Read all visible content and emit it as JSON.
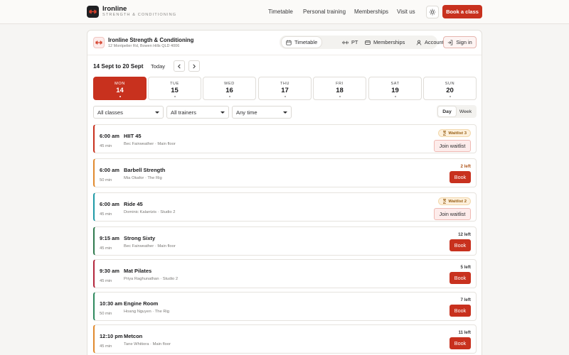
{
  "app": {
    "name": "Ironline",
    "tagline": "STRENGTH & CONDITIONING"
  },
  "nav": {
    "links": [
      "Timetable",
      "Personal training",
      "Memberships",
      "Visit us"
    ],
    "cta": "Book a class",
    "theme_icon": "sun-icon"
  },
  "gym": {
    "name": "Ironline Strength & Conditioning",
    "address": "12 Montpelier Rd, Bowen Hills QLD 4006"
  },
  "tabs": [
    {
      "label": "Timetable",
      "icon": "calendar-icon",
      "active": true
    },
    {
      "label": "PT",
      "icon": "dumbbell-icon",
      "active": false
    },
    {
      "label": "Memberships",
      "icon": "card-icon",
      "active": false
    },
    {
      "label": "Account",
      "icon": "user-icon",
      "active": false
    }
  ],
  "signin": "Sign in",
  "week": {
    "range": "14 Sept to 20 Sept",
    "today_label": "Today"
  },
  "days": [
    {
      "name": "MON",
      "num": "14",
      "active": true
    },
    {
      "name": "TUE",
      "num": "15",
      "active": false
    },
    {
      "name": "WED",
      "num": "16",
      "active": false
    },
    {
      "name": "THU",
      "num": "17",
      "active": false
    },
    {
      "name": "FRI",
      "num": "18",
      "active": false
    },
    {
      "name": "SAT",
      "num": "19",
      "active": false
    },
    {
      "name": "SUN",
      "num": "20",
      "active": false
    }
  ],
  "filters": {
    "classes": "All classes",
    "trainers": "All trainers",
    "time": "Any time"
  },
  "view": {
    "day": "Day",
    "week": "Week",
    "selected": "Day"
  },
  "classes": [
    {
      "time": "6:00 am",
      "duration": "45 min",
      "name": "HIIT 45",
      "meta": "Bec Fairweather · Main floor",
      "status": "Waitlist 3",
      "action": "Join waitlist",
      "kind": "waitlist",
      "accent": "#c8311e"
    },
    {
      "time": "6:00 am",
      "duration": "50 min",
      "name": "Barbell Strength",
      "meta": "Mia Okafor · The Rig",
      "status": "2 left",
      "action": "Book",
      "kind": "low",
      "accent": "#e08a2e"
    },
    {
      "time": "6:00 am",
      "duration": "45 min",
      "name": "Ride 45",
      "meta": "Dominic Kalantzis · Studio 2",
      "status": "Waitlist 2",
      "action": "Join waitlist",
      "kind": "waitlist",
      "accent": "#1f9aa6"
    },
    {
      "time": "9:15 am",
      "duration": "45 min",
      "name": "Strong Sixty",
      "meta": "Bec Fairweather · Main floor",
      "status": "12 left",
      "action": "Book",
      "kind": "open",
      "accent": "#2f7a4e"
    },
    {
      "time": "9:30 am",
      "duration": "45 min",
      "name": "Mat Pilates",
      "meta": "Priya Raghunathan · Studio 2",
      "status": "5 left",
      "action": "Book",
      "kind": "open",
      "accent": "#b3263c"
    },
    {
      "time": "10:30 am",
      "duration": "50 min",
      "name": "Engine Room",
      "meta": "Hoang Nguyen · The Rig",
      "status": "7 left",
      "action": "Book",
      "kind": "open",
      "accent": "#2f8a5e"
    },
    {
      "time": "12:10 pm",
      "duration": "45 min",
      "name": "Metcon",
      "meta": "Tane Whitiora · Main floor",
      "status": "11 left",
      "action": "Book",
      "kind": "open",
      "accent": "#e08a2e"
    }
  ]
}
